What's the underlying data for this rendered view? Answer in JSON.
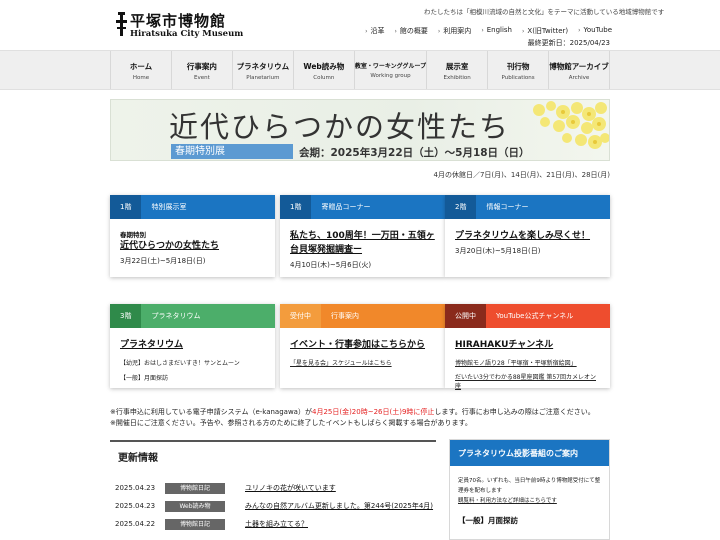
{
  "header": {
    "logo_ja": "平塚市博物館",
    "logo_en": "Hiratsuka City Museum",
    "tagline": "わたしたちは「相模川流域の自然と文化」をテーマに活動している地域博物館です",
    "links": [
      "沿革",
      "館の概要",
      "利用案内",
      "English",
      "X(旧Twitter)",
      "YouTube"
    ],
    "updated": "最終更新日：2025/04/23"
  },
  "nav": [
    {
      "ja": "ホーム",
      "en": "Home"
    },
    {
      "ja": "行事案内",
      "en": "Event"
    },
    {
      "ja": "プラネタリウム",
      "en": "Planetarium"
    },
    {
      "ja": "Web読み物",
      "en": "Column"
    },
    {
      "ja": "教室・ワーキンググループ",
      "en": "Working group"
    },
    {
      "ja": "展示室",
      "en": "Exhibition"
    },
    {
      "ja": "刊行物",
      "en": "Publications"
    },
    {
      "ja": "博物館アーカイブ",
      "en": "Archive"
    }
  ],
  "banner": {
    "title": "近代ひらつかの女性たち",
    "label": "春期特別展",
    "period": "会期：2025年3月22日（土）～5月18日（日）"
  },
  "closed_days": "4月の休館日／7日(月)、14日(月)、21日(月)、28日(月)",
  "cards": [
    {
      "tag": "1階",
      "label": "特別展示室",
      "sub": "春期特別",
      "title": "近代ひらつかの女性たち",
      "date": "3月22日(土)~5月18日(日)",
      "lines": []
    },
    {
      "tag": "1階",
      "label": "寄贈品コーナー",
      "sub": "",
      "title": "私たち、100周年！一万田・五領ヶ台貝塚発掘調査ー",
      "date": "4月10日(木)~5月6日(火)",
      "lines": []
    },
    {
      "tag": "2階",
      "label": "情報コーナー",
      "sub": "",
      "title": "プラネタリウムを楽しみ尽くせ！",
      "date": "3月20日(木)~5月18日(日)",
      "lines": []
    },
    {
      "tag": "3階",
      "label": "プラネタリウム",
      "sub": "",
      "title": "プラネタリウム",
      "date": "",
      "lines": [
        "【幼児】おはしさまだいすき！サンとムーン",
        "【一般】月面探訪"
      ]
    },
    {
      "tag": "受付中",
      "label": "行事案内",
      "sub": "",
      "title": "イベント・行事参加はこちらから",
      "date": "",
      "lines": [
        "「星を見る会」スケジュールはこちら"
      ]
    },
    {
      "tag": "公開中",
      "label": "YouTube公式チャンネル",
      "sub": "",
      "title": "HIRAHAKUチャンネル",
      "date": "",
      "lines": [
        "博物館モノ語り28「平塚宿・平塚新宿絵図」",
        "だいたい3分でわかる88星座図鑑 第57回カメレオン座"
      ]
    }
  ],
  "notice": {
    "line1_a": "※行事申込に利用している電子申請システム（e-kanagawa）が",
    "line1_red": "4月25日(金)20時~26日(土)9時に停止",
    "line1_b": "します。行事にお申し込みの際はご注意ください。",
    "line2": "※開催日にご注意ください。予告や、参照される方のために終了したイベントもしばらく掲載する場合があります。"
  },
  "news": {
    "title": "更新情報",
    "items": [
      {
        "date": "2025.04.23",
        "cat": "博物館日記",
        "text": "ユリノキの花が咲いています"
      },
      {
        "date": "2025.04.23",
        "cat": "Web読み物",
        "text": "みんなの自然アルバム更新しました。第244号(2025年4月)"
      },
      {
        "date": "2025.04.22",
        "cat": "博物館日記",
        "text": "土器を組み立てる？"
      }
    ]
  },
  "side": {
    "title": "プラネタリウム投影番組のご案内",
    "text1": "定員70名。いずれも、当日午前9時より博物館受付にて整理券を配布します",
    "text2": "観覧料・利用方法など詳細はこちらです",
    "program": "【一般】月面探訪"
  },
  "colors": {
    "blue": "#1b75c2",
    "green": "#4cae6a",
    "orange": "#f1882a",
    "red": "#ee4d2e",
    "notice_red": "#e52222"
  }
}
